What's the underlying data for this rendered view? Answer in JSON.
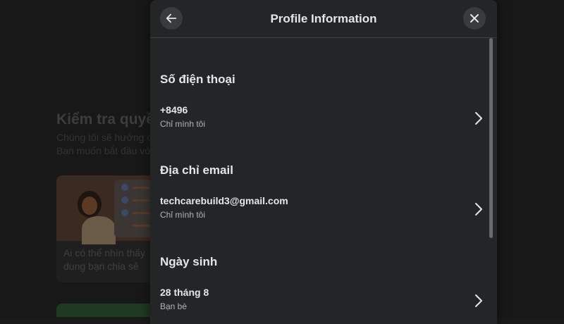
{
  "background_page": {
    "title": "Kiểm tra quyề",
    "desc_line_1": "Chúng tôi sẽ hướng c",
    "desc_line_2": "Bạn muốn bắt đầu vớ",
    "card_text": "Ai có thể nhìn thấy dung bạn chia sẻ"
  },
  "modal": {
    "title": "Profile Information",
    "back_icon": "arrow-left-icon",
    "close_icon": "close-icon"
  },
  "sections": [
    {
      "title": "Số điện thoại",
      "value": "+8496",
      "audience": "Chỉ mình tôi"
    },
    {
      "title": "Địa chỉ email",
      "value": "techcarebuild3@gmail.com",
      "audience": "Chỉ mình tôi"
    },
    {
      "title": "Ngày sinh",
      "value": "28 tháng 8",
      "audience": "Bạn bè"
    }
  ],
  "colors": {
    "modal_bg": "#242526",
    "text_primary": "#e4e6eb",
    "text_secondary": "#b0b3b8",
    "button_bg": "#3a3b3c"
  }
}
